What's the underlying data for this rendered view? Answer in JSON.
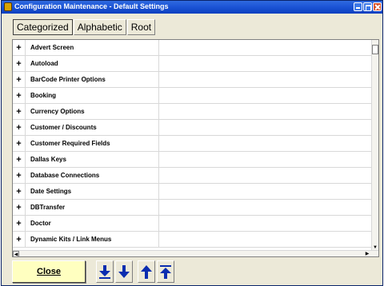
{
  "window": {
    "title": "Configuration Maintenance - Default Settings"
  },
  "tabs": [
    {
      "label": "Categorized",
      "active": true
    },
    {
      "label": "Alphabetic",
      "active": false
    },
    {
      "label": "Root",
      "active": false
    }
  ],
  "grid": {
    "expand_glyph": "+",
    "rows": [
      {
        "name": "Advert Screen"
      },
      {
        "name": "Autoload"
      },
      {
        "name": "BarCode Printer Options"
      },
      {
        "name": "Booking"
      },
      {
        "name": "Currency Options"
      },
      {
        "name": "Customer / Discounts"
      },
      {
        "name": "Customer Required Fields"
      },
      {
        "name": "Dallas Keys"
      },
      {
        "name": "Database Connections"
      },
      {
        "name": "Date Settings"
      },
      {
        "name": "DBTransfer"
      },
      {
        "name": "Doctor"
      },
      {
        "name": "Dynamic Kits / Link Menus"
      }
    ]
  },
  "footer": {
    "close_label": "Close",
    "nav_buttons": [
      "move-to-bottom",
      "move-down",
      "move-up",
      "move-to-top"
    ]
  },
  "colors": {
    "titlebar": "#1d55d6",
    "window_bg": "#ece9d8",
    "close_button_bg": "#ffffc0",
    "nav_arrow": "#0a2db0"
  }
}
